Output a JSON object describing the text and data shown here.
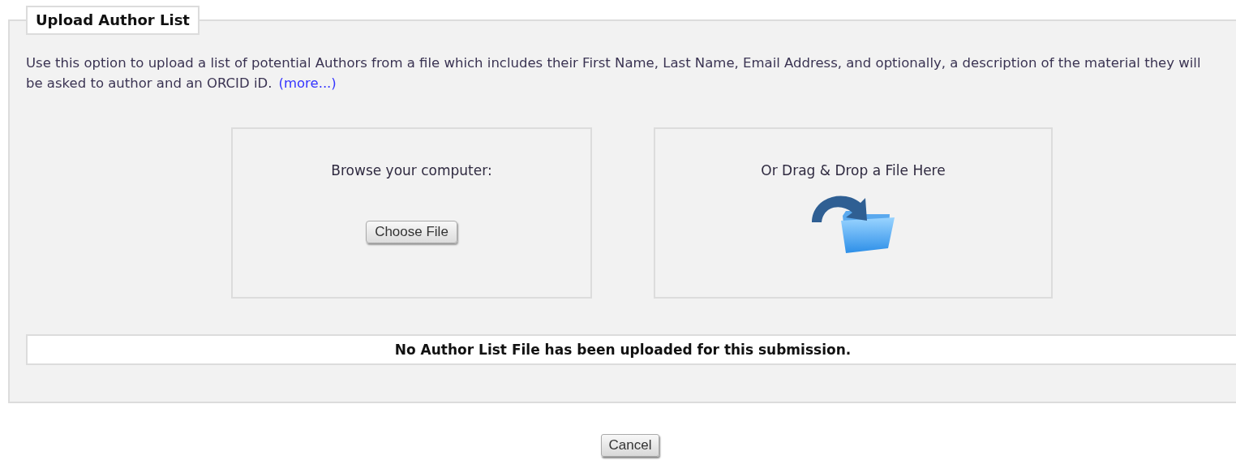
{
  "panel": {
    "title": "Upload Author List",
    "description": "Use this option to upload a list of potential Authors from a file which includes their First Name, Last Name, Email Address, and optionally, a description of the material they will be asked to author and an ORCID iD.",
    "more_link": "(more...)",
    "browse": {
      "label": "Browse your computer:",
      "button": "Choose File"
    },
    "drop": {
      "label": "Or Drag & Drop a File Here"
    },
    "status": "No Author List File has been uploaded for this submission."
  },
  "buttons": [
    "Cancel"
  ]
}
